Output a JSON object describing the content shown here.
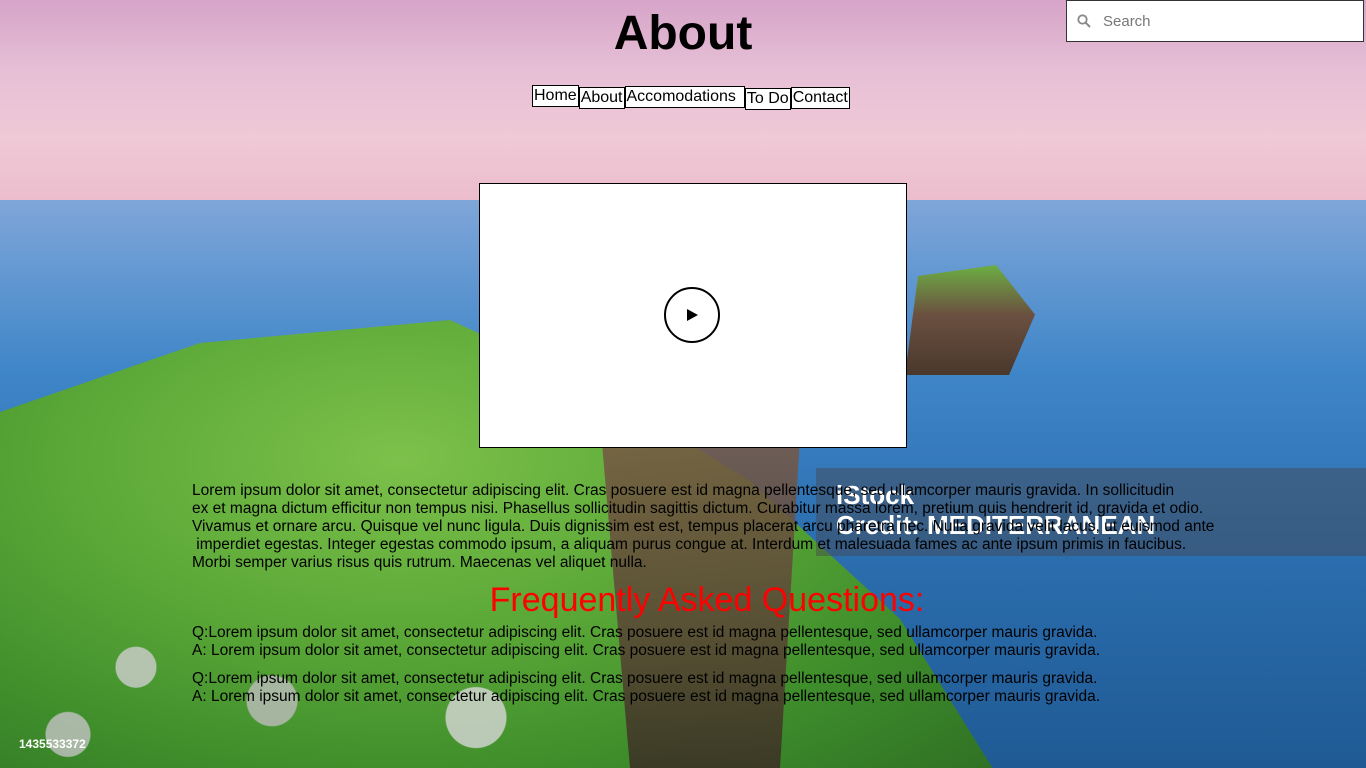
{
  "header": {
    "title": "About"
  },
  "search": {
    "placeholder": "Search"
  },
  "nav": {
    "items": [
      "Home",
      "About",
      "Accomodations",
      "To Do",
      "Contact"
    ]
  },
  "video": {
    "play_icon": "play-icon"
  },
  "main": {
    "intro_lines": [
      "Lorem ipsum dolor sit amet, consectetur adipiscing elit. Cras posuere est id magna pellentesque, sed ullamcorper mauris gravida. In sollicitudin",
      "ex et magna dictum efficitur non tempus nisi. Phasellus sollicitudin sagittis dictum. Curabitur massa lorem, pretium quis hendrerit id, gravida et odio.",
      "Vivamus et ornare arcu. Quisque vel nunc ligula. Duis dignissim est est, tempus placerat arcu pharetra nec. Nulla gravida velit lacus, ut euismod ante",
      " imperdiet egestas. Integer egestas commodo ipsum, a aliquam purus congue at. Interdum et malesuada fames ac ante ipsum primis in faucibus.",
      "Morbi semper varius risus quis rutrum. Maecenas vel aliquet nulla."
    ],
    "faq_heading": "Frequently Asked Questions:",
    "faqs": [
      {
        "q": "Q:Lorem ipsum dolor sit amet, consectetur adipiscing elit. Cras posuere est id magna pellentesque, sed ullamcorper mauris gravida.",
        "a": "A: Lorem ipsum dolor sit amet, consectetur adipiscing elit. Cras posuere est id magna pellentesque, sed ullamcorper mauris gravida."
      },
      {
        "q": "Q:Lorem ipsum dolor sit amet, consectetur adipiscing elit. Cras posuere est id magna pellentesque, sed ullamcorper mauris gravida.",
        "a": "A: Lorem ipsum dolor sit amet, consectetur adipiscing elit. Cras posuere est id magna pellentesque, sed ullamcorper mauris gravida."
      }
    ]
  },
  "background": {
    "watermark_lines": [
      "iStock",
      "Credit: MEDITERRANEAN"
    ],
    "stock_id": "1435533372"
  },
  "colors": {
    "faq_heading": "#ff0000"
  }
}
